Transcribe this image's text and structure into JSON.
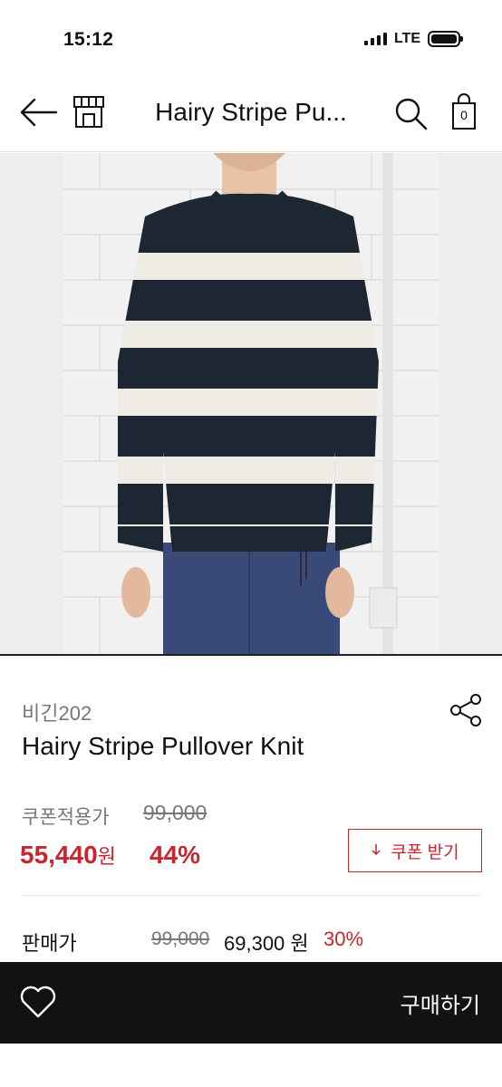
{
  "status_bar": {
    "time": "15:12",
    "network": "LTE"
  },
  "nav": {
    "title": "Hairy Stripe Pu...",
    "cart_count": "0",
    "icons": [
      "back-arrow-icon",
      "store-icon",
      "search-icon",
      "cart-icon"
    ]
  },
  "product": {
    "brand": "비긴202",
    "name": "Hairy Stripe Pullover Knit",
    "image_desc_colors": {
      "stripe_dark": "#1d2733",
      "stripe_light": "#efece6",
      "pants": "#3a4a78",
      "wall": "#f2f2f2"
    }
  },
  "coupon": {
    "label": "쿠폰적용가",
    "original_price": "99,000",
    "sale_price": "55,440",
    "won": "원",
    "rate": "44%",
    "button_label": "쿠폰 받기",
    "button_icon": "download-icon"
  },
  "price_row": {
    "label": "판매가",
    "original_price": "99,000",
    "price": "69,300 원",
    "rate": "30%"
  },
  "bottom": {
    "buy_label": "구매하기",
    "icon": "heart-icon"
  },
  "colors": {
    "accent": "#c9252c",
    "bottom_bar": "#121212"
  }
}
